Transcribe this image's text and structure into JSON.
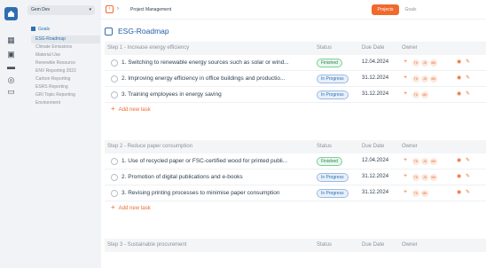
{
  "workspace": {
    "name": "Gem Dev"
  },
  "breadcrumb": "Project Management",
  "tabs": [
    {
      "label": "Projects"
    },
    {
      "label": "Goals"
    }
  ],
  "sidebar": {
    "header": "Goals",
    "items": [
      {
        "label": "ESG-Roadmap"
      },
      {
        "label": "Climate Emissions"
      },
      {
        "label": "Material Use"
      },
      {
        "label": "Renewble Resource"
      },
      {
        "label": "ENV Reporting 2022"
      },
      {
        "label": "Carbon Reporting"
      },
      {
        "label": "ESRS Reporting"
      },
      {
        "label": "GRI Topic Reporting"
      },
      {
        "label": "Environment"
      }
    ]
  },
  "page": {
    "title": "ESG-Roadmap"
  },
  "columns": {
    "status": "Status",
    "due": "Due Date",
    "owner": "Owner"
  },
  "add_label": "Add new task",
  "steps": [
    {
      "title": "Step 1 - Increase energy efficiency",
      "tasks": [
        {
          "title": "1. Switching to renewable energy sources such as solar or wind...",
          "status": "Finished",
          "date": "12.04.2024",
          "owners": [
            "TK",
            "JS",
            "MK"
          ]
        },
        {
          "title": "2. Improving energy efficiency in office buildings and productio...",
          "status": "In Progress",
          "date": "31.12.2024",
          "owners": [
            "TK",
            "JS",
            "MK"
          ]
        },
        {
          "title": "3. Training employees in energy saving",
          "status": "In Progress",
          "date": "31.12.2024",
          "owners": [
            "TK",
            "MK"
          ]
        }
      ]
    },
    {
      "title": "Step 2 - Reduce paper consumption",
      "tasks": [
        {
          "title": "1. Use of recycled paper or FSC-certified wood for printed publi...",
          "status": "Finished",
          "date": "12.04.2024",
          "owners": [
            "TK",
            "JS",
            "MK"
          ]
        },
        {
          "title": "2. Promotion of digital publications and e-books",
          "status": "In Progress",
          "date": "31.12.2024",
          "owners": [
            "TK",
            "JS",
            "MK"
          ]
        },
        {
          "title": "3. Revising printing processes to minimise paper consumption",
          "status": "In Progress",
          "date": "31.12.2024",
          "owners": [
            "TK",
            "MK"
          ]
        }
      ]
    },
    {
      "title": "Step 3 - Sustainable procurement",
      "tasks": []
    }
  ],
  "colors": {
    "accent": "#f06a2e",
    "primary": "#2f6fb0"
  }
}
